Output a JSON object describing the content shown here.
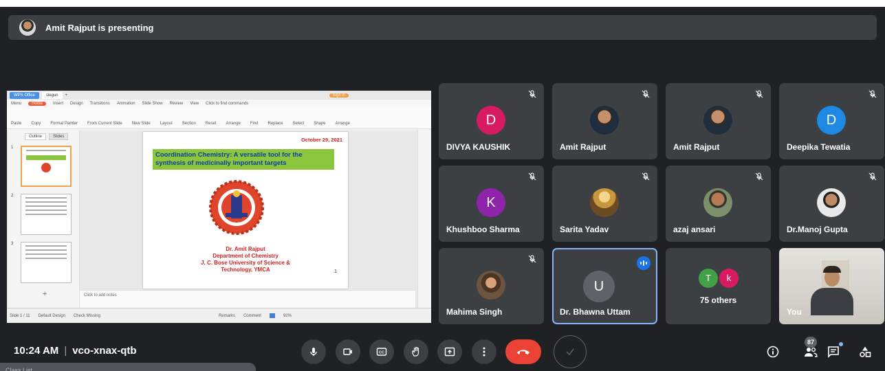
{
  "banner": {
    "text": "Amit Rajput is presenting"
  },
  "presentation": {
    "app_tabs": [
      "WPS Office",
      "slegun",
      "+"
    ],
    "sign_in": "Sign in",
    "menu": [
      "Menu",
      "Home",
      "Insert",
      "Design",
      "Transitions",
      "Animation",
      "Slide Show",
      "Review",
      "View",
      "Click to find commands"
    ],
    "ribbon": [
      "Paste",
      "Copy",
      "Format Painter",
      "From Current Slide",
      "New Slide",
      "Layout",
      "Section",
      "Reset",
      "Arrange",
      "Find",
      "Replace",
      "Select",
      "Shape",
      "Arrange"
    ],
    "outline_tabs": [
      "Outline",
      "Slides"
    ],
    "slide_numbers": [
      "1",
      "2",
      "3"
    ],
    "add_slide": "+",
    "notes_placeholder": "Click to add notes",
    "status_left": [
      "Slide 1 / 11",
      "Default Design",
      "Check Missing"
    ],
    "status_right": [
      "Remarks",
      "Comment",
      "92%"
    ],
    "slide": {
      "date": "October 29, 2021",
      "title": "Coordination Chemistry: A versatile tool for the synthesis of medicinally important targets",
      "presenter": "Dr. Amit Rajput",
      "department": "Department of Chemistry",
      "university_line1": "J. C. Bose University of Science &",
      "university_line2": "Technology, YMCA",
      "page_number": "1"
    }
  },
  "participants": [
    {
      "name": "DIVYA KAUSHIK",
      "avatar_letter": "D",
      "avatar_color": "#d81b60",
      "muted": true
    },
    {
      "name": "Amit Rajput",
      "avatar_type": "photo",
      "muted": true
    },
    {
      "name": "Amit Rajput",
      "avatar_type": "photo",
      "muted": true
    },
    {
      "name": "Deepika Tewatia",
      "avatar_letter": "D",
      "avatar_color": "#1e88e5",
      "muted": true
    },
    {
      "name": "Khushboo Sharma",
      "avatar_letter": "K",
      "avatar_color": "#8e24aa",
      "muted": true
    },
    {
      "name": "Sarita Yadav",
      "avatar_type": "photo",
      "muted": true
    },
    {
      "name": "azaj ansari",
      "avatar_type": "photo",
      "muted": true
    },
    {
      "name": "Dr.Manoj Gupta",
      "avatar_type": "photo",
      "muted": true
    },
    {
      "name": "Mahima Singh",
      "avatar_type": "photo",
      "muted": true
    },
    {
      "name": "Dr. Bhawna Uttam",
      "avatar_letter": "U",
      "avatar_color": "#5f6368",
      "speaking": true
    }
  ],
  "others": {
    "label": "75 others",
    "avatars": [
      {
        "letter": "T",
        "color": "#43a047"
      },
      {
        "letter": "k",
        "color": "#d81b60"
      }
    ]
  },
  "self_view": {
    "label": "You"
  },
  "bottom": {
    "time": "10:24 AM",
    "separator": "|",
    "meeting_code": "vco-xnax-qtb",
    "people_count": "87"
  },
  "taskbar": {
    "label": "Class List"
  },
  "colors": {
    "background": "#202124",
    "tile": "#3c4043",
    "end_call": "#ea4335",
    "speaking": "#1a73e8",
    "slide_title_bg": "#8cc63f"
  }
}
